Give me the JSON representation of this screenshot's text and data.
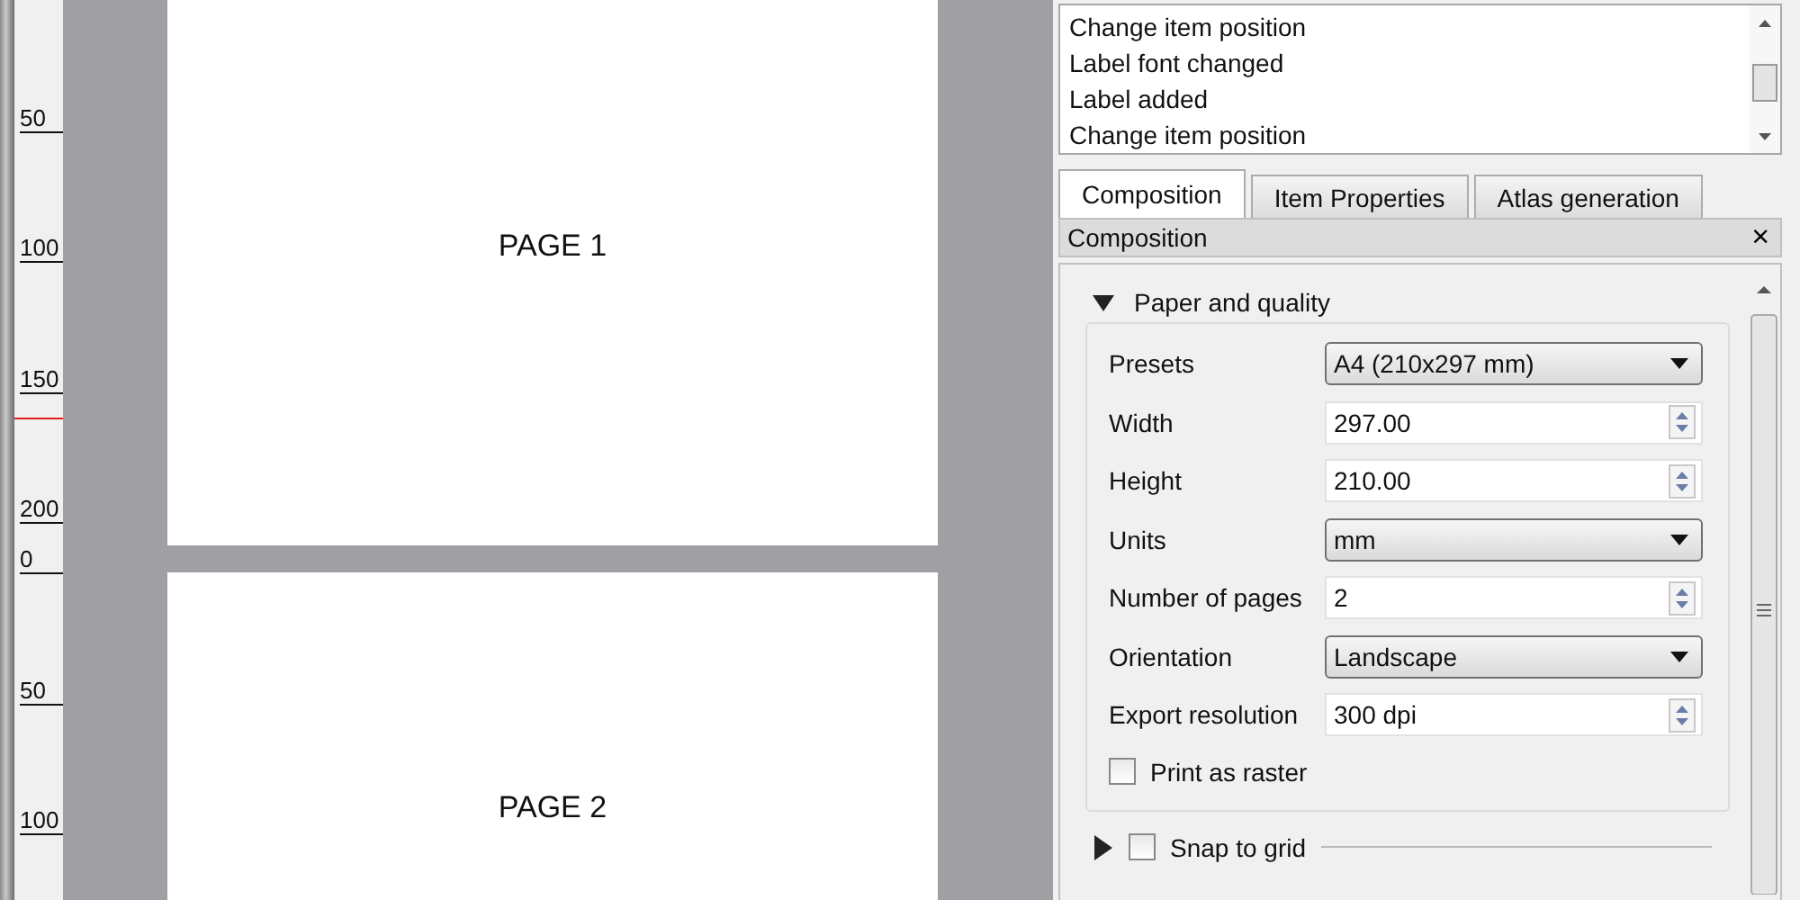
{
  "ruler": {
    "labels": [
      "50",
      "100",
      "150",
      "200",
      "0",
      "50",
      "100"
    ]
  },
  "pages": [
    {
      "label": "PAGE 1"
    },
    {
      "label": "PAGE 2"
    }
  ],
  "history": {
    "items": [
      "Change item position",
      "Label font changed",
      "Label added",
      "Change item position"
    ]
  },
  "tabs": [
    {
      "label": "Composition",
      "selected": true
    },
    {
      "label": "Item Properties",
      "selected": false
    },
    {
      "label": "Atlas generation",
      "selected": false
    }
  ],
  "dock": {
    "title": "Composition",
    "close": "×"
  },
  "group": {
    "title": "Paper and quality",
    "expanded": true,
    "fields": [
      {
        "kind": "combo",
        "label": "Presets",
        "value": "A4 (210x297 mm)"
      },
      {
        "kind": "spin",
        "label": "Width",
        "value": "297.00"
      },
      {
        "kind": "spin",
        "label": "Height",
        "value": "210.00"
      },
      {
        "kind": "combo",
        "label": "Units",
        "value": "mm"
      },
      {
        "kind": "spin",
        "label": "Number of pages",
        "value": "2"
      },
      {
        "kind": "combo",
        "label": "Orientation",
        "value": "Landscape"
      },
      {
        "kind": "spin",
        "label": "Export resolution",
        "value": "300 dpi"
      }
    ],
    "print_as_raster": {
      "label": "Print as raster",
      "checked": false
    }
  },
  "snap_group": {
    "title": "Snap to grid",
    "expanded": false,
    "checked": false
  }
}
